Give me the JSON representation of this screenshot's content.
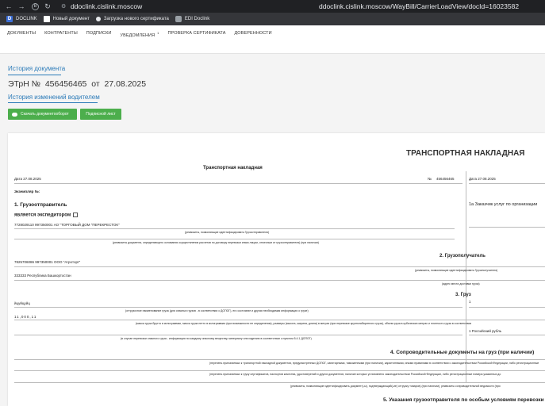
{
  "browser": {
    "url_short": "ddoclink.cislink.moscow",
    "url_full": "ddoclink.cislink.moscow/WayBill/CarrierLoadView/docId=16023582"
  },
  "bookmarks": [
    {
      "label": "DOCLINK",
      "icon": "doclink-icon"
    },
    {
      "label": "Новый документ",
      "icon": "document-icon"
    },
    {
      "label": "Загрузка нового сертификата",
      "icon": "dot-icon"
    },
    {
      "label": "EDI Doclink",
      "icon": "gear-icon"
    }
  ],
  "menu": [
    {
      "label": "Документы"
    },
    {
      "label": "Контрагенты"
    },
    {
      "label": "Подписки"
    },
    {
      "label": "Уведомления",
      "badge": "1"
    },
    {
      "label": "Проверка сертификата"
    },
    {
      "label": "Доверенности"
    }
  ],
  "page": {
    "history_link": "История документа",
    "doc_type": "ЭТрН №",
    "doc_number": "456456465",
    "doc_from": "от",
    "doc_date": "27.08.2025",
    "driver_history_link": "История изменений водителем",
    "download_button": "Скачать документооборот",
    "sign_sheet_button": "Подписной лист"
  },
  "sheet": {
    "main_title": "ТРАНСПОРТНАЯ НАКЛАДНАЯ",
    "left_title": "Транспортная накладная",
    "date_left": "Дата  27.08.2025",
    "number_label": "№",
    "number_value": "456456465",
    "date_right": "Дата  27.08.2025",
    "copy_no": "Экземпляр №:",
    "s1": "1. Грузоотправитель",
    "s1_expeditor": "является экспедитором",
    "s1_value": "7728029110 997350001 АО \"ТОРГОВЫЙ ДОМ \"ПЕРЕКРЕСТОК\"",
    "s1_hint": "(реквизиты, позволяющие идентифицировать Грузоотправителя)",
    "s1_hint2": "(реквизиты документа, определяющего основания осуществления расчетов по договору перевозки иным лицом, отличным от грузоотправителя) (при наличии)",
    "s1a": "1а Заказчик услуг по организации",
    "s2": "2. Грузополучатель",
    "s2_value": "7825706086 997350001 ООО \"Агроторг\"",
    "s2_hint": "(реквизиты, позволяющие идентифицировать Грузополучателя)",
    "s2_address": "333333 Республика Башкортостан",
    "s2_address_hint": "(адрес места доставки груза)",
    "s3": "3. Груз",
    "s3_right": "1",
    "s3_cargo": "йцуйцуйц",
    "s3_cargo_hint": "(отгрузочное наименование груза (для опасных грузов - в соответствии с ДОПОГ), его состояние и другая необходимая информация о грузе)",
    "s3_weight": "11,000,11",
    "s3_weight_hint": "(масса груза брутто в килограммах, масса груза нетто в килограммах (при возможности ее определения), размеры (высота, ширина, длина) в метрах (при перевозке крупногабаритного груза), объем груза в кубических метрах и плотность груза в соответствии",
    "s3_currency": "1 Российский рубль",
    "s3_danger_hint": "(в случае перевозки опасного груза - информация по каждому опасному веществу, материалу или изделию в соответствии с пунктом 5.4.1 ДОПОГ)",
    "s4": "4. Сопроводительные документы на груз (при наличии)",
    "s4_hint1": "(перечень прилагаемых к транспортной накладной документов, предусмотренных ДОПОГ, санитарными, таможенными (при наличии), карантинными, иными правилами в соответствии с законодательством Российской Федерации, либо регистрационные",
    "s4_hint2": "(перечень прилагаемых к грузу сертификатов, паспортов качества, удостоверений и других документов, наличие которых установлено законодательством Российской Федерации, либо регистрационные номера указанных до",
    "s4_hint3": "(реквизиты, позволяющие идентифицировать документ(-ы), подтверждающий(-ие) отгрузку товаров) (при наличии), реквизиты сопроводительной ведомости (при",
    "s5": "5. Указания грузоотправителя по особым условиям перевозки"
  }
}
